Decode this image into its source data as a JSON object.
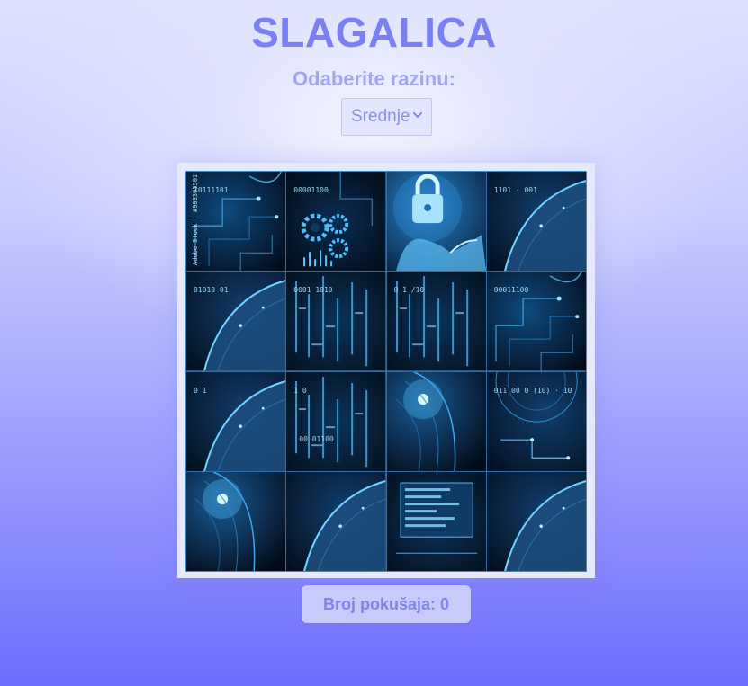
{
  "app": {
    "title": "SLAGALICA"
  },
  "level": {
    "label": "Odaberite razinu:",
    "selected": "Srednje"
  },
  "board": {
    "rows": 4,
    "cols": 4,
    "tiles": [
      {
        "id": 1,
        "motif": "circuit-lines",
        "texts": [
          "10111101",
          "Adobe Stock | #903305501"
        ]
      },
      {
        "id": 2,
        "motif": "gears",
        "texts": [
          "00001100"
        ]
      },
      {
        "id": 3,
        "motif": "padlock-hand",
        "texts": []
      },
      {
        "id": 4,
        "motif": "helmet-curve",
        "texts": [
          "1101 · 001"
        ]
      },
      {
        "id": 5,
        "motif": "helmet-curve",
        "texts": [
          "01010 01"
        ]
      },
      {
        "id": 6,
        "motif": "binary-rain",
        "texts": [
          "0001 1010"
        ]
      },
      {
        "id": 7,
        "motif": "binary-rain",
        "texts": [
          "0 1 /10"
        ]
      },
      {
        "id": 8,
        "motif": "circuit-lines",
        "texts": [
          "00011100"
        ]
      },
      {
        "id": 9,
        "motif": "helmet-curve",
        "texts": [
          "0 1"
        ]
      },
      {
        "id": 10,
        "motif": "binary-rain",
        "texts": [
          "1 0",
          "00 01100"
        ]
      },
      {
        "id": 11,
        "motif": "glow-face",
        "texts": []
      },
      {
        "id": 12,
        "motif": "globe-circuit",
        "texts": [
          "011 00 0 (10) · 10"
        ]
      },
      {
        "id": 13,
        "motif": "glow-face",
        "texts": []
      },
      {
        "id": 14,
        "motif": "helmet-curve",
        "texts": []
      },
      {
        "id": 15,
        "motif": "data-screen",
        "texts": []
      },
      {
        "id": 16,
        "motif": "helmet-curve",
        "texts": []
      }
    ]
  },
  "status": {
    "attempts_label": "Broj pokušaja: 0"
  },
  "colors": {
    "title": "#7a7ff5",
    "tile_dark": "#03101f",
    "tile_glow": "#3fb4ff",
    "background_bottom": "#6f6cff"
  }
}
